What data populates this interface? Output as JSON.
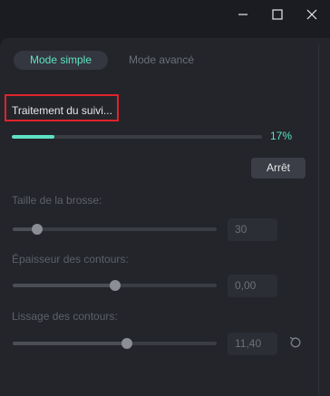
{
  "window_controls": {
    "minimize_icon": "minimize-icon",
    "maximize_icon": "maximize-icon",
    "close_icon": "close-icon"
  },
  "tabs": [
    {
      "label": "Mode simple",
      "active": true
    },
    {
      "label": "Mode avancé",
      "active": false
    }
  ],
  "tracking": {
    "status_text": "Traitement du suivi...",
    "progress_fraction": 0.17,
    "progress_label": "17%",
    "stop_label": "Arrêt"
  },
  "params": [
    {
      "label": "Taille de la brosse:",
      "value": "30",
      "level": 0.12
    },
    {
      "label": "Épaisseur des contours:",
      "value": "0,00",
      "level": 0.5
    },
    {
      "label": "Lissage des contours:",
      "value": "11,40",
      "level": 0.56
    }
  ],
  "reset_icon": "reset-icon",
  "colors": {
    "accent": "#5de2c4",
    "highlight_border": "#e0222b",
    "background": "#1b1c21",
    "panel": "#23252b"
  }
}
